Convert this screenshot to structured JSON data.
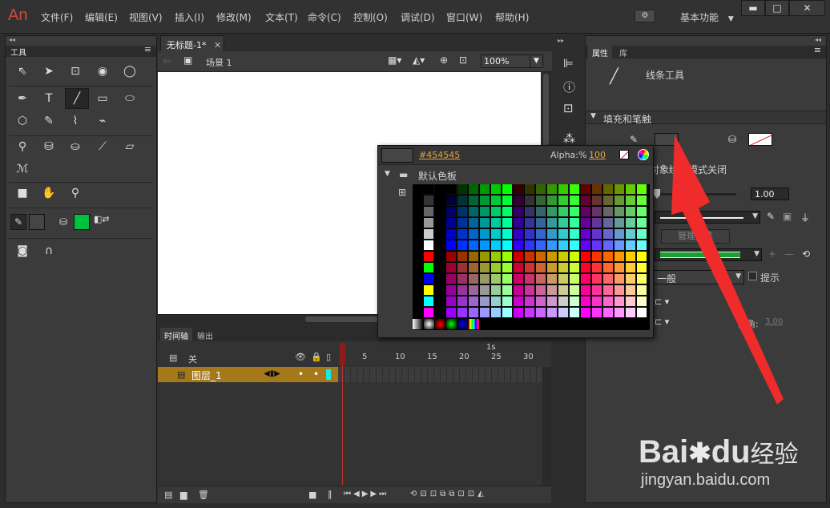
{
  "app": {
    "logo": "An"
  },
  "menu": [
    "文件(F)",
    "编辑(E)",
    "视图(V)",
    "插入(I)",
    "修改(M)",
    "文本(T)",
    "命令(C)",
    "控制(O)",
    "调试(D)",
    "窗口(W)",
    "帮助(H)"
  ],
  "workspace": "基本功能",
  "toolsPanel": {
    "title": "工具"
  },
  "document": {
    "tab": "无标题-1*",
    "scene": "场景 1",
    "zoom": "100%"
  },
  "timeline": {
    "tabs": [
      "时间轴",
      "输出"
    ],
    "header_label": "关",
    "layer": "图层_1",
    "ticks": [
      "1",
      "5",
      "10",
      "15",
      "20",
      "25",
      "30"
    ],
    "seconds_label": "1s"
  },
  "properties": {
    "tabs": [
      "属性",
      "库"
    ],
    "tool_name": "线条工具",
    "section": "填充和笔触",
    "object_draw": "对象绘制模式关闭",
    "stroke_size": "1.00",
    "manage_label": "管理画笔",
    "scale": "一般",
    "hint_label": "提示",
    "miter_label": "尖角:",
    "miter_value": "3.00"
  },
  "colorPicker": {
    "hex": "#454545",
    "alpha_label": "Alpha:%",
    "alpha_value": "100",
    "palette_label": "默认色板"
  },
  "watermark": {
    "brand": "Bai",
    "brand2": "du",
    "suffix": "经验",
    "url": "jingyan.baidu.com"
  },
  "colors": {
    "fill": "#00c040",
    "accent": "#e8242a",
    "hexText": "#e6a23a"
  }
}
